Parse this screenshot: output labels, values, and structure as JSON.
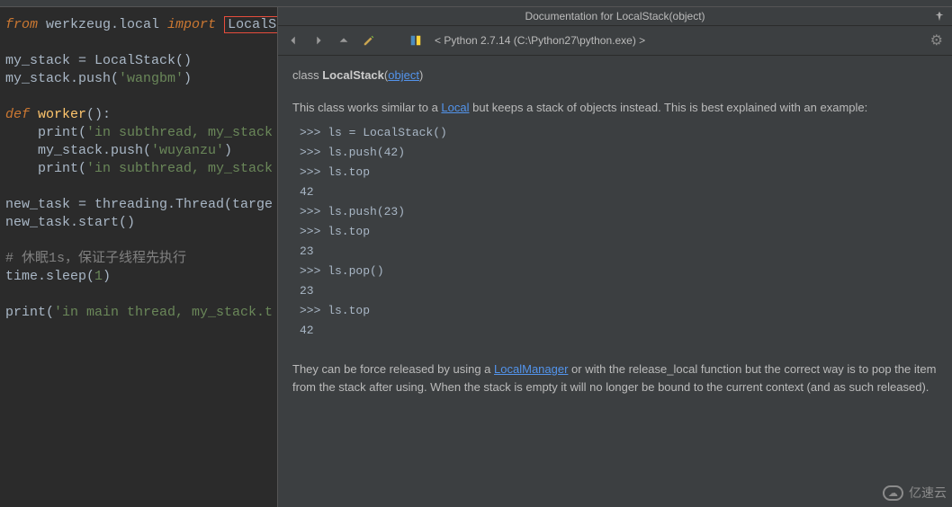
{
  "code": {
    "l1_from": "from",
    "l1_mod": " werkzeug.local ",
    "l1_import": "import",
    "l1_space": " ",
    "l1_name": "LocalStack",
    "l3": "my_stack = LocalStack()",
    "l4a": "my_stack.push(",
    "l4s": "'wangbm'",
    "l4b": ")",
    "l6_def": "def",
    "l6_name": " worker",
    "l6_rest": "():",
    "l7a": "    print(",
    "l7s": "'in subthread, my_stack",
    "l8a": "    my_stack.push(",
    "l8s": "'wuyanzu'",
    "l8b": ")",
    "l9a": "    print(",
    "l9s": "'in subthread, my_stack",
    "l11": "new_task = threading.Thread(targe",
    "l12": "new_task.start()",
    "l14": "# 休眠1s，保证子线程先执行",
    "l15a": "time.sleep(",
    "l15n": "1",
    "l15b": ")",
    "l17a": "print(",
    "l17s": "'in main thread, my_stack.t"
  },
  "doc": {
    "title": "Documentation for LocalStack(object)",
    "interpreter": "< Python 2.7.14 (C:\\Python27\\python.exe) >",
    "class_kw": "class ",
    "class_name": "LocalStack",
    "class_paren_open": "(",
    "class_parent": "object",
    "class_paren_close": ")",
    "desc_a": "This class works similar to a ",
    "desc_link": "Local",
    "desc_b": " but keeps a stack of objects instead. This is best explained with an example:",
    "example": ">>> ls = LocalStack()\n>>> ls.push(42)\n>>> ls.top\n42\n>>> ls.push(23)\n>>> ls.top\n23\n>>> ls.pop()\n23\n>>> ls.top\n42",
    "footer_a": "They can be force released by using a ",
    "footer_link": "LocalManager",
    "footer_b": " or with the release_local function but the correct way is to pop the item from the stack after using. When the stack is empty it will no longer be bound to the current context (and as such released)."
  },
  "watermark": "亿速云"
}
